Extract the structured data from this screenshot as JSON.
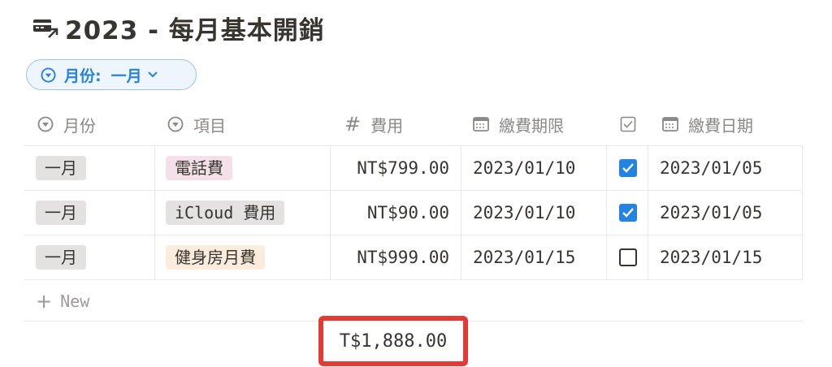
{
  "page": {
    "title": "2023 - 每月基本開銷",
    "title_icon": "card-arrow-icon"
  },
  "filter": {
    "label": "月份:",
    "value": "一月",
    "icon": "circle-chevron-icon"
  },
  "columns": [
    {
      "label": "月份",
      "icon": "select-icon"
    },
    {
      "label": "項目",
      "icon": "select-icon"
    },
    {
      "label": "費用",
      "icon": "number-hash-icon"
    },
    {
      "label": "繳費期限",
      "icon": "calendar-icon"
    },
    {
      "label": "",
      "icon": "checkbox-icon"
    },
    {
      "label": "繳費日期",
      "icon": "calendar-icon"
    }
  ],
  "rows": [
    {
      "month": "一月",
      "item": "電話費",
      "item_color": "pink",
      "cost": "NT$799.00",
      "due": "2023/01/10",
      "paid": true,
      "paid_date": "2023/01/05"
    },
    {
      "month": "一月",
      "item": "iCloud 費用",
      "item_color": "gray",
      "cost": "NT$90.00",
      "due": "2023/01/10",
      "paid": true,
      "paid_date": "2023/01/05"
    },
    {
      "month": "一月",
      "item": "健身房月費",
      "item_color": "orange",
      "cost": "NT$999.00",
      "due": "2023/01/15",
      "paid": false,
      "paid_date": "2023/01/15"
    }
  ],
  "new_row": {
    "label": "New"
  },
  "sum": {
    "value": "T$1,888.00"
  },
  "colors": {
    "accent": "#2383e2",
    "highlight_border": "#e53935"
  }
}
